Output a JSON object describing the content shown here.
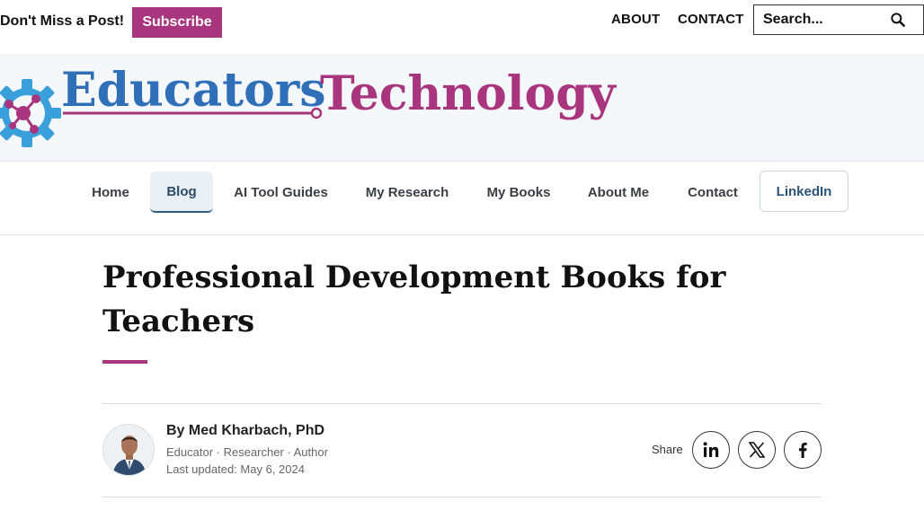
{
  "topbar": {
    "promo_text": "Don't Miss a Post!",
    "subscribe_label": "Subscribe",
    "links": [
      "ABOUT",
      "CONTACT"
    ],
    "search_placeholder": "Search..."
  },
  "brand": {
    "name_part1": "Educators",
    "name_part2": "Technology",
    "color_blue": "#2f6fb8",
    "color_magenta": "#a8357e",
    "gear_color": "#3aa0dc"
  },
  "nav": {
    "items": [
      "Home",
      "Blog",
      "AI Tool Guides",
      "My Research",
      "My Books",
      "About Me",
      "Contact",
      "LinkedIn"
    ],
    "active": "Blog"
  },
  "article": {
    "title": "Professional Development Books for Teachers",
    "author": "By Med Kharbach, PhD",
    "roles": "Educator · Researcher · Author",
    "updated": "Last updated: May 6, 2024",
    "share_label": "Share"
  },
  "share_icons": [
    "linkedin-icon",
    "x-icon",
    "facebook-icon"
  ]
}
